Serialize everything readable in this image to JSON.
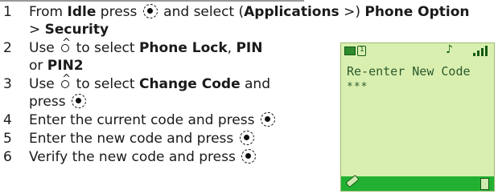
{
  "steps": [
    {
      "number": "1",
      "prefix": "From ",
      "idle": "Idle",
      "press": " press ",
      "and_select": " and select (",
      "applications": "Applications",
      "arrow1": " >) ",
      "phone_option": "Phone Option",
      "line2_prefix": "> ",
      "security": "Security"
    },
    {
      "number": "2",
      "use": "Use ",
      "to_select": " to select ",
      "phone_lock": "Phone Lock",
      "comma": ", ",
      "pin": "PIN",
      "or": "or ",
      "pin2": "PIN2"
    },
    {
      "number": "3",
      "use": "Use ",
      "to_select": " to select ",
      "change_code": "Change Code",
      "and": " and",
      "press": "press "
    },
    {
      "number": "4",
      "text": "Enter the current code and press "
    },
    {
      "number": "5",
      "text": "Enter the new code and press "
    },
    {
      "number": "6",
      "text": "Verify the new code and press "
    }
  ],
  "phone": {
    "message": "Re-enter New Code",
    "code_mask": "***",
    "icons": [
      "battery-icon",
      "line-1-icon",
      "music-icon",
      "signal-strength-icon",
      "pen-icon",
      "phonebook-icon"
    ],
    "colors": {
      "screen_bg": "#d9efb0",
      "softkey_bar": "#22b032",
      "text": "#2b5a2b"
    }
  }
}
